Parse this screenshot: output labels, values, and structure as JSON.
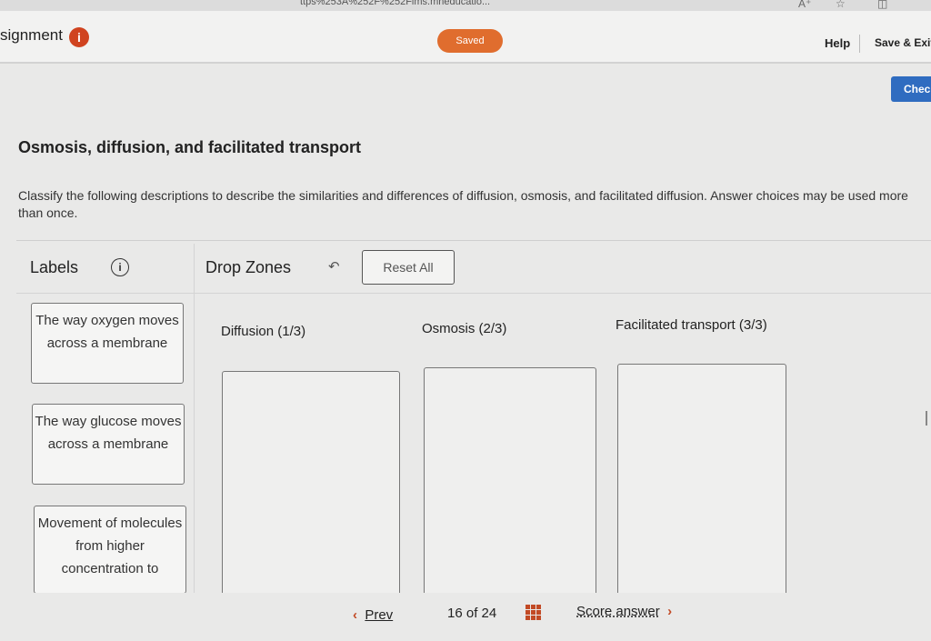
{
  "browser": {
    "url_fragment": "ttps%253A%252F%252Fims.mheducatio...",
    "icons": [
      "read-aloud-icon",
      "favorite-star-icon",
      "split-screen-icon"
    ]
  },
  "header": {
    "assignment_label": "signment",
    "info_glyph": "i",
    "status": "Saved",
    "help": "Help",
    "save_exit": "Save & Exit"
  },
  "check_button": "Check",
  "question": {
    "title": "Osmosis, diffusion, and facilitated transport",
    "instructions": "Classify the following descriptions to describe the similarities and differences of diffusion, osmosis, and facilitated diffusion. Answer choices may be used more than once."
  },
  "labels_panel": {
    "title": "Labels",
    "info_glyph": "i",
    "items": [
      "The way oxygen moves across a membrane",
      "The way glucose moves across a membrane",
      "Movement of molecules from higher concentration to"
    ]
  },
  "drop_panel": {
    "title": "Drop Zones",
    "undo_glyph": "↶",
    "reset": "Reset All",
    "zones": [
      {
        "label": "Diffusion (1/3)"
      },
      {
        "label": "Osmosis (2/3)"
      },
      {
        "label": "Facilitated transport (3/3)"
      }
    ]
  },
  "footer": {
    "prev": "Prev",
    "prev_glyph": "‹",
    "page_current": "16",
    "page_of": "of",
    "page_total": "24",
    "score": "Score answer",
    "next_glyph": "›"
  },
  "colors": {
    "accent": "#e06d2e",
    "info_red": "#d0431f",
    "check_blue": "#2f6cc0"
  }
}
